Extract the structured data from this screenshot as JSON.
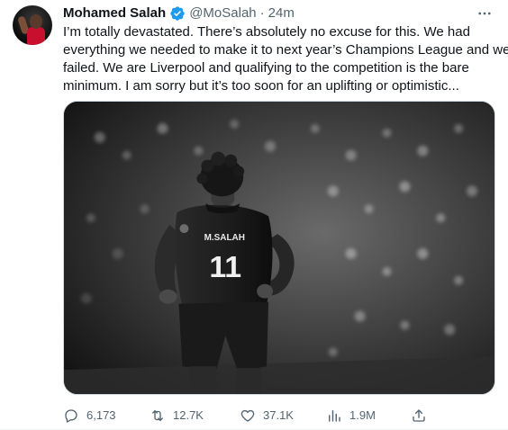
{
  "author": {
    "name": "Mohamed Salah",
    "handle": "@MoSalah",
    "separator": "·",
    "timestamp": "24m",
    "verified": true
  },
  "tweet": {
    "lines": [
      "I’m totally devastated. There’s absolutely no excuse for this. We had",
      "everything we needed to make it to next year’s Champions League and we",
      "failed. We are Liverpool and qualifying to the competition is the bare",
      "minimum. I am sorry but it’s too soon for an uplifting or optimistic..."
    ]
  },
  "media": {
    "jersey_name": "M.SALAH",
    "jersey_number": "11"
  },
  "actions": {
    "replies": "6,173",
    "retweets": "12.7K",
    "likes": "37.1K",
    "views": "1.9M"
  },
  "icons": {
    "verified": "verified-badge-icon",
    "more": "more-options-icon",
    "reply": "reply-icon",
    "retweet": "retweet-icon",
    "like": "heart-icon",
    "views": "views-chart-icon",
    "share": "share-icon"
  },
  "colors": {
    "verified_blue": "#1d9bf0",
    "secondary_text": "#536471",
    "primary_text": "#0f1419",
    "avatar_jersey": "#c8102e"
  }
}
